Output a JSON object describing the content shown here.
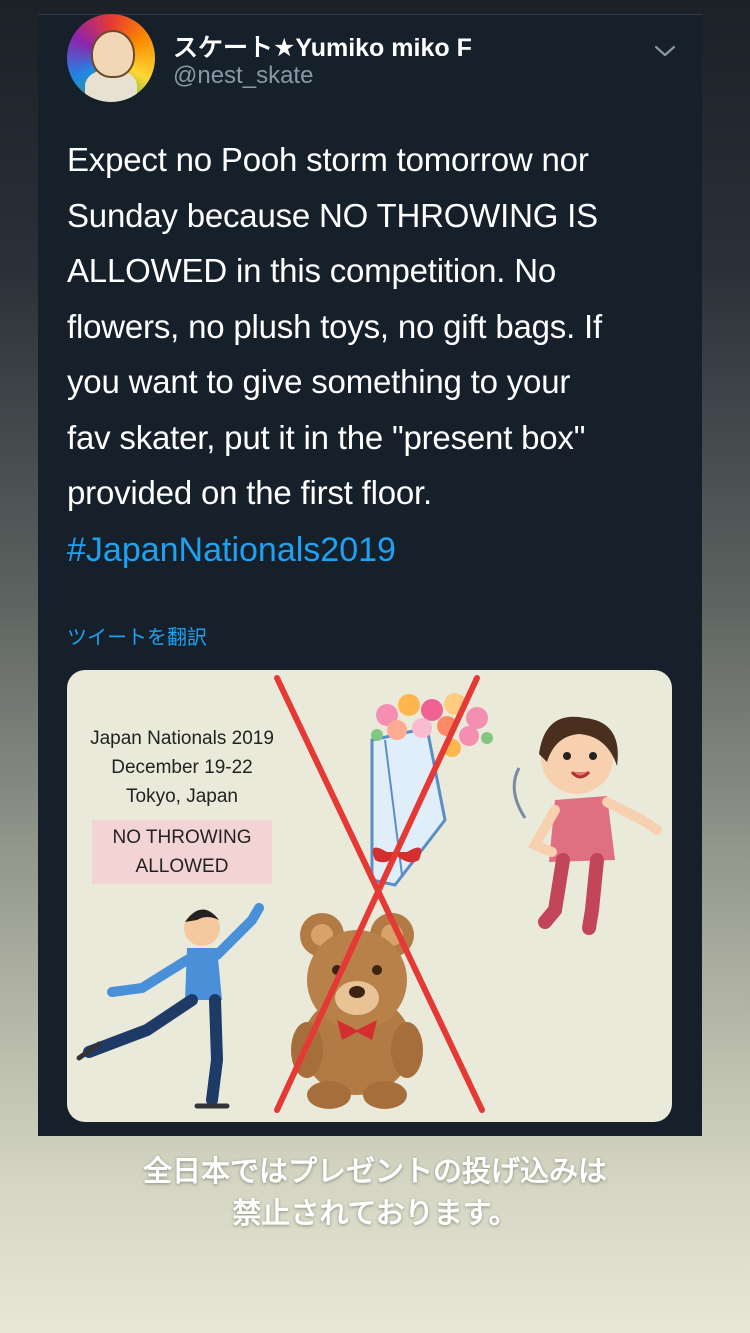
{
  "tweet": {
    "display_name": "スケート★Yumiko miko F",
    "handle": "@nest_skate",
    "text": "Expect no Pooh storm tomorrow nor\nSunday because NO THROWING IS\nALLOWED in this competition.  No\nflowers, no plush toys, no gift bags. If\nyou want to give something to your\nfav skater, put it in the \"present box\"\nprovided on the first floor.",
    "hashtag": "#JapanNationals2019",
    "translate_label": "ツイートを翻訳",
    "menu_icon": "chevron-down-icon",
    "image": {
      "info_lines": [
        "Japan Nationals 2019",
        "December 19-22",
        "Tokyo, Japan"
      ],
      "badge_lines": [
        "NO THROWING",
        "ALLOWED"
      ],
      "depicts": [
        "figure-skater",
        "flower-bouquet",
        "teddy-bear",
        "throwing-girl",
        "red-x-mark"
      ]
    }
  },
  "caption": {
    "line1": "全日本ではプレゼントの投げ込みは",
    "line2": "禁止されております。"
  },
  "colors": {
    "card_bg": "#15202b",
    "link_blue": "#1da1f2",
    "handle_gray": "#8899a6",
    "cross_red": "#e53935",
    "image_bg": "#eaeadb"
  }
}
